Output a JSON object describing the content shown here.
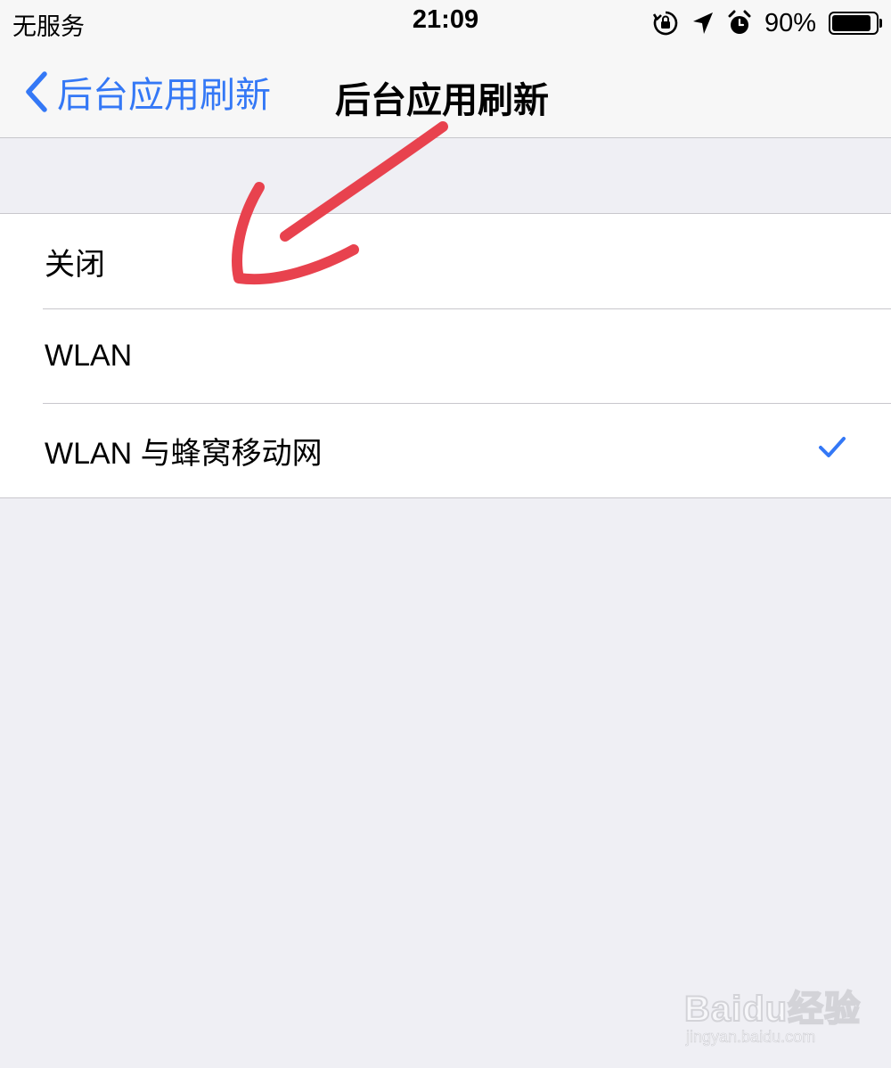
{
  "status_bar": {
    "carrier": "无服务",
    "time": "21:09",
    "battery_percent": "90%",
    "battery_level": 0.9,
    "icons": [
      "rotation-lock-icon",
      "location-arrow-icon",
      "alarm-icon",
      "battery-icon"
    ]
  },
  "nav": {
    "back_label": "后台应用刷新",
    "title": "后台应用刷新"
  },
  "options": [
    {
      "label": "关闭",
      "selected": false
    },
    {
      "label": "WLAN",
      "selected": false
    },
    {
      "label": "WLAN 与蜂窝移动网",
      "selected": true
    }
  ],
  "colors": {
    "accent": "#3478f6",
    "annotation": "#e8424e",
    "background": "#efeff4"
  },
  "watermark": {
    "logo": "Baidu经验",
    "url": "jingyan.baidu.com"
  }
}
